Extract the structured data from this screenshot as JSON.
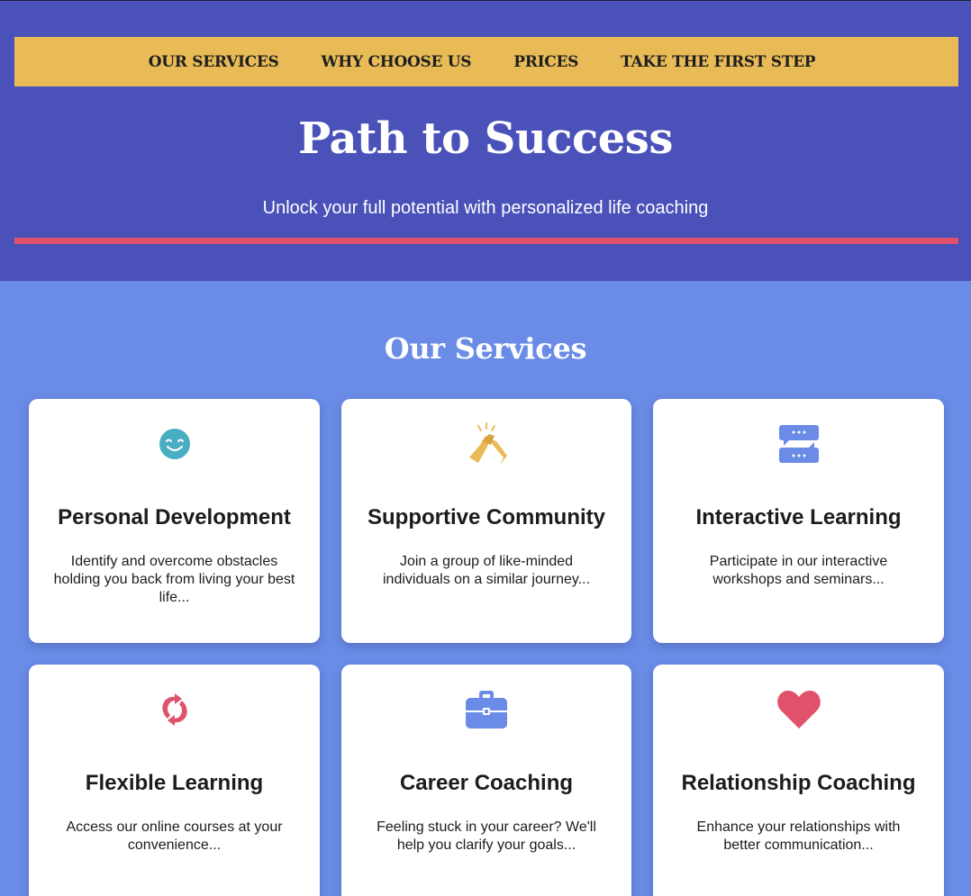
{
  "nav": {
    "items": [
      {
        "label": "OUR SERVICES"
      },
      {
        "label": "WHY CHOOSE US"
      },
      {
        "label": "PRICES"
      },
      {
        "label": "TAKE THE FIRST STEP"
      }
    ]
  },
  "hero": {
    "title": "Path to Success",
    "subtitle": "Unlock your full potential with personalized life coaching"
  },
  "services": {
    "title": "Our Services",
    "cards": [
      {
        "icon": "smiling-face-icon",
        "title": "Personal Development",
        "text": "Identify and overcome obstacles holding you back from living your best life..."
      },
      {
        "icon": "high-five-icon",
        "title": "Supportive Community",
        "text": "Join a group of like-minded individuals on a similar journey..."
      },
      {
        "icon": "chat-exchange-icon",
        "title": "Interactive Learning",
        "text": "Participate in our interactive workshops and seminars..."
      },
      {
        "icon": "refresh-arrows-icon",
        "title": "Flexible Learning",
        "text": "Access our online courses at your convenience..."
      },
      {
        "icon": "briefcase-icon",
        "title": "Career Coaching",
        "text": "Feeling stuck in your career? We'll help you clarify your goals..."
      },
      {
        "icon": "heart-icon",
        "title": "Relationship Coaching",
        "text": "Enhance your relationships with better communication..."
      }
    ]
  },
  "colors": {
    "header_bg": "#4a51b9",
    "nav_bg": "#e9bb57",
    "accent_rule": "#e0526c",
    "page_bg": "#6a8ce6"
  }
}
